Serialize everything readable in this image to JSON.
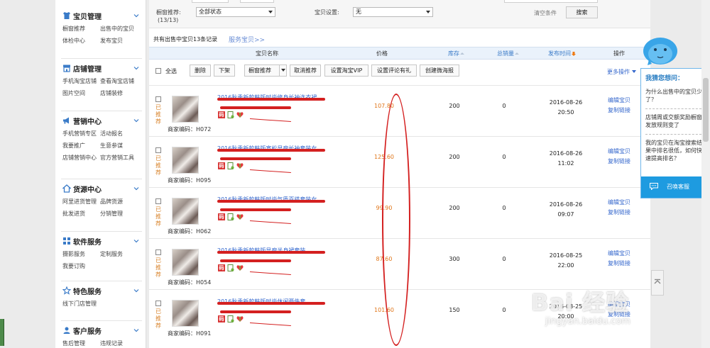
{
  "sidebar": {
    "sections": [
      {
        "title": "宝贝管理",
        "icon": "shirt-icon",
        "links": [
          "橱窗推荐",
          "出售中的宝贝",
          "体检中心",
          "发布宝贝"
        ]
      },
      {
        "title": "店铺管理",
        "icon": "shop-icon",
        "links": [
          "手机淘宝店铺",
          "查看淘宝店铺",
          "图片空间",
          "店铺装修"
        ]
      },
      {
        "title": "营销中心",
        "icon": "megaphone-icon",
        "links": [
          "手机营销专区",
          "活动报名",
          "我要推广",
          "生意参谋",
          "店铺营销中心",
          "官方营销工具"
        ]
      },
      {
        "title": "货源中心",
        "icon": "house-icon",
        "links": [
          "阿里进货管理",
          "品牌货源",
          "批发进货",
          "分销管理"
        ]
      },
      {
        "title": "软件服务",
        "icon": "grid-icon",
        "links": [
          "摄影服务",
          "定制服务",
          "我要订购"
        ]
      },
      {
        "title": "特色服务",
        "icon": "star-icon",
        "links": [
          "线下门店管理"
        ]
      },
      {
        "title": "客户服务",
        "icon": "person-icon",
        "links": [
          "售后管理",
          "违规记录"
        ]
      }
    ]
  },
  "filters": {
    "window_label": "橱窗推荐:",
    "window_count": "(13/13)",
    "window_value": "全部状态",
    "setting_label": "宝贝设置:",
    "setting_value": "无",
    "clear_label": "清空条件",
    "search_label": "搜索"
  },
  "summary": {
    "count_text": "共有出售中宝贝13条记录",
    "service_link": "服务宝贝>>"
  },
  "table": {
    "headers": {
      "name": "宝贝名称",
      "price": "价格",
      "stock": "库存",
      "sales": "总销量",
      "date": "发布时间",
      "ops": "操作"
    }
  },
  "toolbar": {
    "select_all": "全选",
    "delete": "删除",
    "offline": "下架",
    "recommend": "橱窗推荐",
    "cancel_recommend": "取消推荐",
    "vip": "设置淘宝VIP",
    "review_gift": "设置评论有礼",
    "weitao": "创建微海报",
    "more_ops": "更多操作"
  },
  "rows": [
    {
      "rec": "已推荐",
      "code": "商家编码：H072",
      "title": "2016秋季新款韩版时尚修身长袖连衣裙",
      "price": "107.80",
      "stock": "200",
      "sales": "0",
      "date": "2016-08-26",
      "time": "20:50",
      "edit": "编辑宝贝",
      "copy": "复制链接"
    },
    {
      "rec": "已推荐",
      "code": "商家编码：H095",
      "title": "2016秋季新款韩版宽松显瘦长袖套装女",
      "price": "125.60",
      "stock": "200",
      "sales": "0",
      "date": "2016-08-26",
      "time": "11:02",
      "edit": "编辑宝贝",
      "copy": "复制链接"
    },
    {
      "rec": "已推荐",
      "code": "商家编码：H062",
      "title": "2016秋季新款韩版时尚气质百搭套装女",
      "price": "99.90",
      "stock": "200",
      "sales": "0",
      "date": "2016-08-26",
      "time": "09:07",
      "edit": "编辑宝贝",
      "copy": "复制链接"
    },
    {
      "rec": "已推荐",
      "code": "商家编码：H054",
      "title": "2016秋季新款韩版显瘦半身裙套装",
      "price": "87.60",
      "stock": "300",
      "sales": "0",
      "date": "2016-08-25",
      "time": "22:00",
      "edit": "编辑宝贝",
      "copy": "复制链接"
    },
    {
      "rec": "已推荐",
      "code": "商家编码：H091",
      "title": "2016秋季新款韩版时尚休闲两件套",
      "price": "101.60",
      "stock": "150",
      "sales": "0",
      "date": "2016-08-25",
      "time": "20:00",
      "edit": "编辑宝贝",
      "copy": "复制链接"
    }
  ],
  "help": {
    "title": "我猜您想问：",
    "questions": [
      "为什么出售中的宝贝少了？",
      "店铺周或交额奖励橱窗发放规则变了",
      "我的宝贝在淘宝搜索结果中排名很低，如何快速提高排名？"
    ],
    "cta": "召唤客服"
  },
  "watermark": {
    "main": "Bai 经验",
    "sub": "jingyan.baidu.com"
  },
  "colors": {
    "accent": "#3366cc",
    "price": "#e0761a",
    "recommend": "#d9852e",
    "annotation": "#d42020",
    "help_blue": "#1e9be0"
  }
}
